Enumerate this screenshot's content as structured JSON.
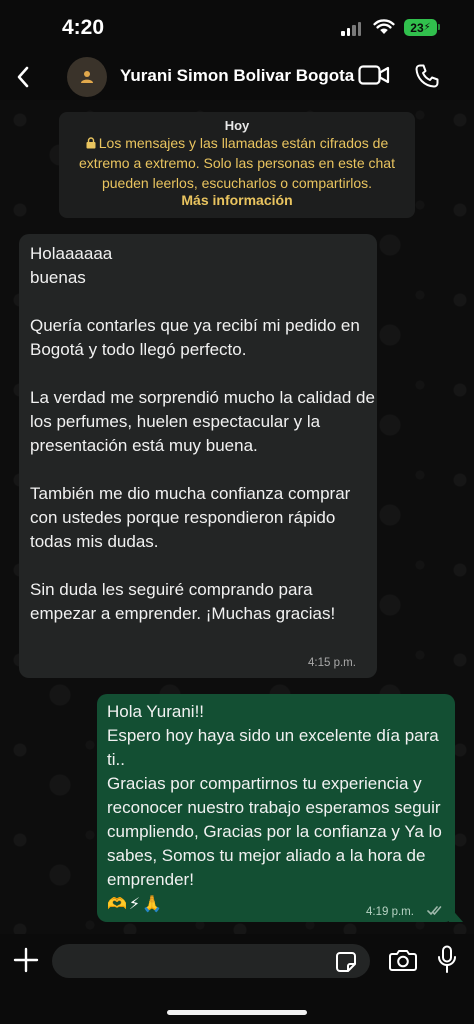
{
  "status_bar": {
    "time": "4:20",
    "battery": "23"
  },
  "header": {
    "contact_name": "Yurani Simon Bolivar Bogota",
    "icons": [
      "back-chevron-icon",
      "person-icon",
      "video-icon",
      "phone-icon"
    ]
  },
  "encryption_notice": {
    "date": "Hoy",
    "text": "Los mensajes y las llamadas están cifrados de extremo a extremo. Solo las personas en este chat pueden leerlos, escucharlos o compartirlos.",
    "link": "Más información"
  },
  "messages": [
    {
      "direction": "incoming",
      "text": "Holaaaaaa\nbuenas\n\nQuería contarles que ya recibí mi pedido en Bogotá y todo llegó perfecto.\n\nLa verdad me sorprendió mucho la calidad de los perfumes, huelen espectacular y la presentación está muy buena.\n\nTambién me dio mucha confianza comprar con ustedes porque respondieron rápido todas mis dudas.\n\nSin duda les seguiré comprando para empezar a emprender. ¡Muchas gracias!",
      "time": "4:15 p.m."
    },
    {
      "direction": "outgoing",
      "text": "Hola Yurani!!\nEspero hoy haya sido un excelente día para ti..\nGracias por compartirnos tu experiencia y reconocer nuestro trabajo esperamos seguir cumpliendo, Gracias por la confianza y Ya lo sabes, Somos tu mejor aliado a la hora de emprender!",
      "emojis": "🫶⚡🙏",
      "time": "4:19 p.m.",
      "status": "read"
    }
  ],
  "composer": {
    "placeholder": "",
    "icons": [
      "plus-icon",
      "sticker-icon",
      "camera-icon",
      "mic-icon"
    ]
  },
  "colors": {
    "background": "#0b0b0b",
    "incoming_bubble": "#232525",
    "outgoing_bubble": "#134f33",
    "encryption_text": "#e9c45f",
    "read_ticks": "#9fb8ab"
  }
}
